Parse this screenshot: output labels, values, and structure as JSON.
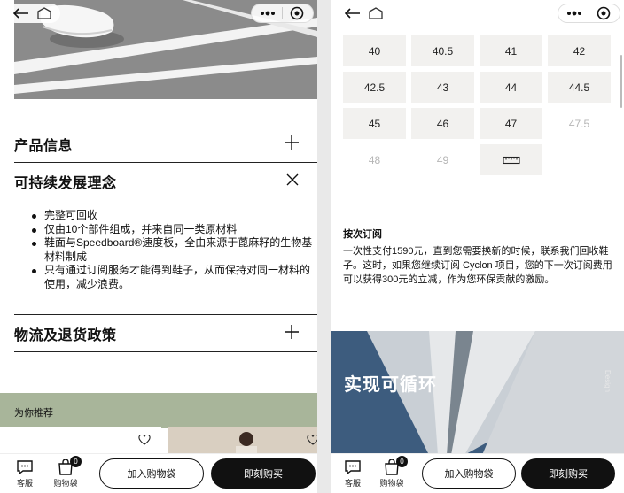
{
  "left": {
    "accordion": [
      {
        "title": "产品信息",
        "icon": "plus-icon"
      },
      {
        "title": "可持续发展理念",
        "icon": "close-icon"
      },
      {
        "title": "物流及退货政策",
        "icon": "plus-icon"
      }
    ],
    "bullets": [
      "完整可回收",
      "仅由10个部件组成，并来自同一类原材料",
      "鞋面与Speedboard®速度板，全由来源于蓖麻籽的生物基材料制成",
      "只有通过订阅服务才能得到鞋子，从而保持对同一材料的使用，减少浪费。"
    ],
    "recommend_title": "为你推荐"
  },
  "right": {
    "sizes": [
      {
        "label": "40",
        "available": true
      },
      {
        "label": "40.5",
        "available": true
      },
      {
        "label": "41",
        "available": true
      },
      {
        "label": "42",
        "available": true
      },
      {
        "label": "42.5",
        "available": true
      },
      {
        "label": "43",
        "available": true
      },
      {
        "label": "44",
        "available": true
      },
      {
        "label": "44.5",
        "available": true
      },
      {
        "label": "45",
        "available": true
      },
      {
        "label": "46",
        "available": true
      },
      {
        "label": "47",
        "available": true
      },
      {
        "label": "47.5",
        "available": false
      },
      {
        "label": "48",
        "available": false
      },
      {
        "label": "49",
        "available": false
      }
    ],
    "subscription_title": "按次订阅",
    "subscription_body": "一次性支付1590元，直到您需要换新的时候，联系我们回收鞋子。这时，如果您继续订阅 Cyclon 项目，您的下一次订阅费用可以获得300元的立减，作为您环保贡献的激励。",
    "hero_headline": "实现可循环",
    "hero_vertical": "Design"
  },
  "bottombar": {
    "service_label": "客服",
    "cart_label": "购物袋",
    "cart_count": "0",
    "add_to_cart": "加入购物袋",
    "buy_now": "即刻购买"
  },
  "colors": {
    "recommend_bg": "#a8b59a",
    "button_dark": "#111111",
    "size_cell_bg": "#f2f1ef"
  }
}
